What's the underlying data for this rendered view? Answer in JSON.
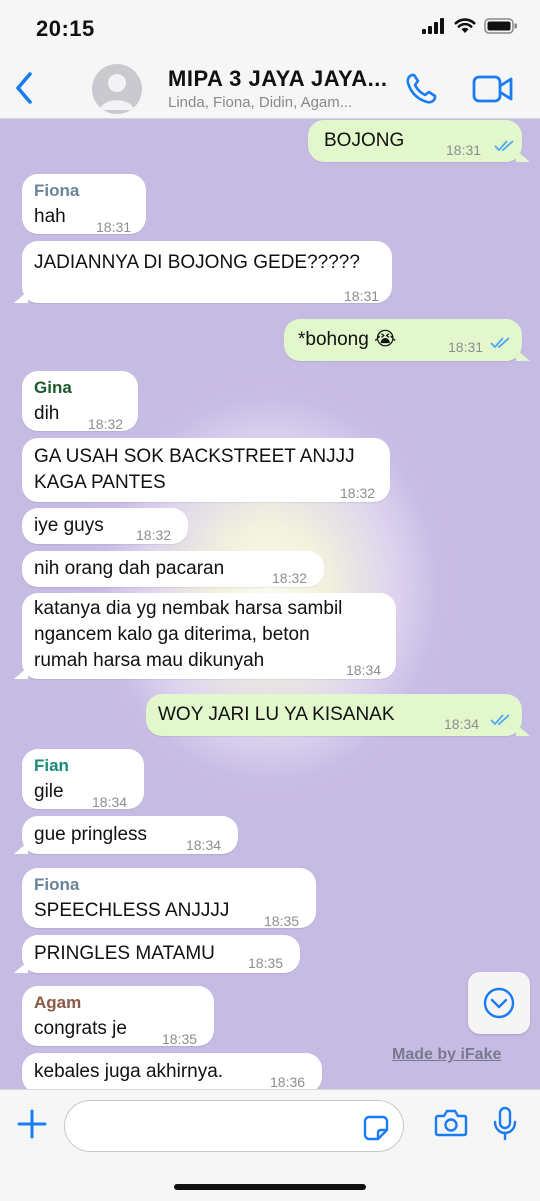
{
  "status_bar": {
    "time": "20:15"
  },
  "header": {
    "group_name": "MIPA 3 JAYA JAYA...",
    "members": "Linda, Fiona, Didin, Agam..."
  },
  "colors": {
    "accent": "#1a7cf2",
    "outgoing": "#e2f7cb",
    "incoming": "#ffffff",
    "read_ticks": "#4fa8f2"
  },
  "messages": [
    {
      "dir": "out",
      "text": "BOJONG",
      "time": "18:31",
      "status": "read"
    },
    {
      "dir": "in",
      "sender": "Fiona",
      "sender_color": "#6a8597",
      "text": "hah",
      "time": "18:31"
    },
    {
      "dir": "in",
      "text": "JADIANNYA DI BOJONG GEDE?????",
      "time": "18:31"
    },
    {
      "dir": "out",
      "text": "*bohong 😭",
      "time": "18:31",
      "status": "read"
    },
    {
      "dir": "in",
      "sender": "Gina",
      "sender_color": "#1f5a2b",
      "text": "dih",
      "time": "18:32"
    },
    {
      "dir": "in",
      "text_lines": [
        "GA USAH SOK BACKSTREET ANJJJ",
        "KAGA PANTES"
      ],
      "time": "18:32"
    },
    {
      "dir": "in",
      "text": "iye guys",
      "time": "18:32"
    },
    {
      "dir": "in",
      "text": "nih orang dah pacaran",
      "time": "18:32"
    },
    {
      "dir": "in",
      "text_lines": [
        "katanya dia yg nembak harsa sambil",
        "ngancem kalo ga diterima, beton",
        "rumah harsa mau dikunyah"
      ],
      "time": "18:34"
    },
    {
      "dir": "out",
      "text": "WOY JARI LU YA KISANAK",
      "time": "18:34",
      "status": "read"
    },
    {
      "dir": "in",
      "sender": "Fian",
      "sender_color": "#1a8a7a",
      "text": "gile",
      "time": "18:34"
    },
    {
      "dir": "in",
      "text": "gue pringless",
      "time": "18:34"
    },
    {
      "dir": "in",
      "sender": "Fiona",
      "sender_color": "#6a8597",
      "text": "SPEECHLESS ANJJJJ",
      "time": "18:35"
    },
    {
      "dir": "in",
      "text": "PRINGLES MATAMU",
      "time": "18:35"
    },
    {
      "dir": "in",
      "sender": "Agam",
      "sender_color": "#8a5a48",
      "text": "congrats je",
      "time": "18:35"
    },
    {
      "dir": "in",
      "text": "kebales juga akhirnya.",
      "time": "18:36"
    }
  ],
  "watermark": "Made by iFake",
  "icons": [
    "back-chevron-icon",
    "avatar-placeholder-icon",
    "phone-icon",
    "video-camera-icon",
    "scroll-down-icon",
    "plus-icon",
    "sticker-icon",
    "camera-icon",
    "microphone-icon",
    "signal-icon",
    "wifi-icon",
    "battery-icon"
  ]
}
